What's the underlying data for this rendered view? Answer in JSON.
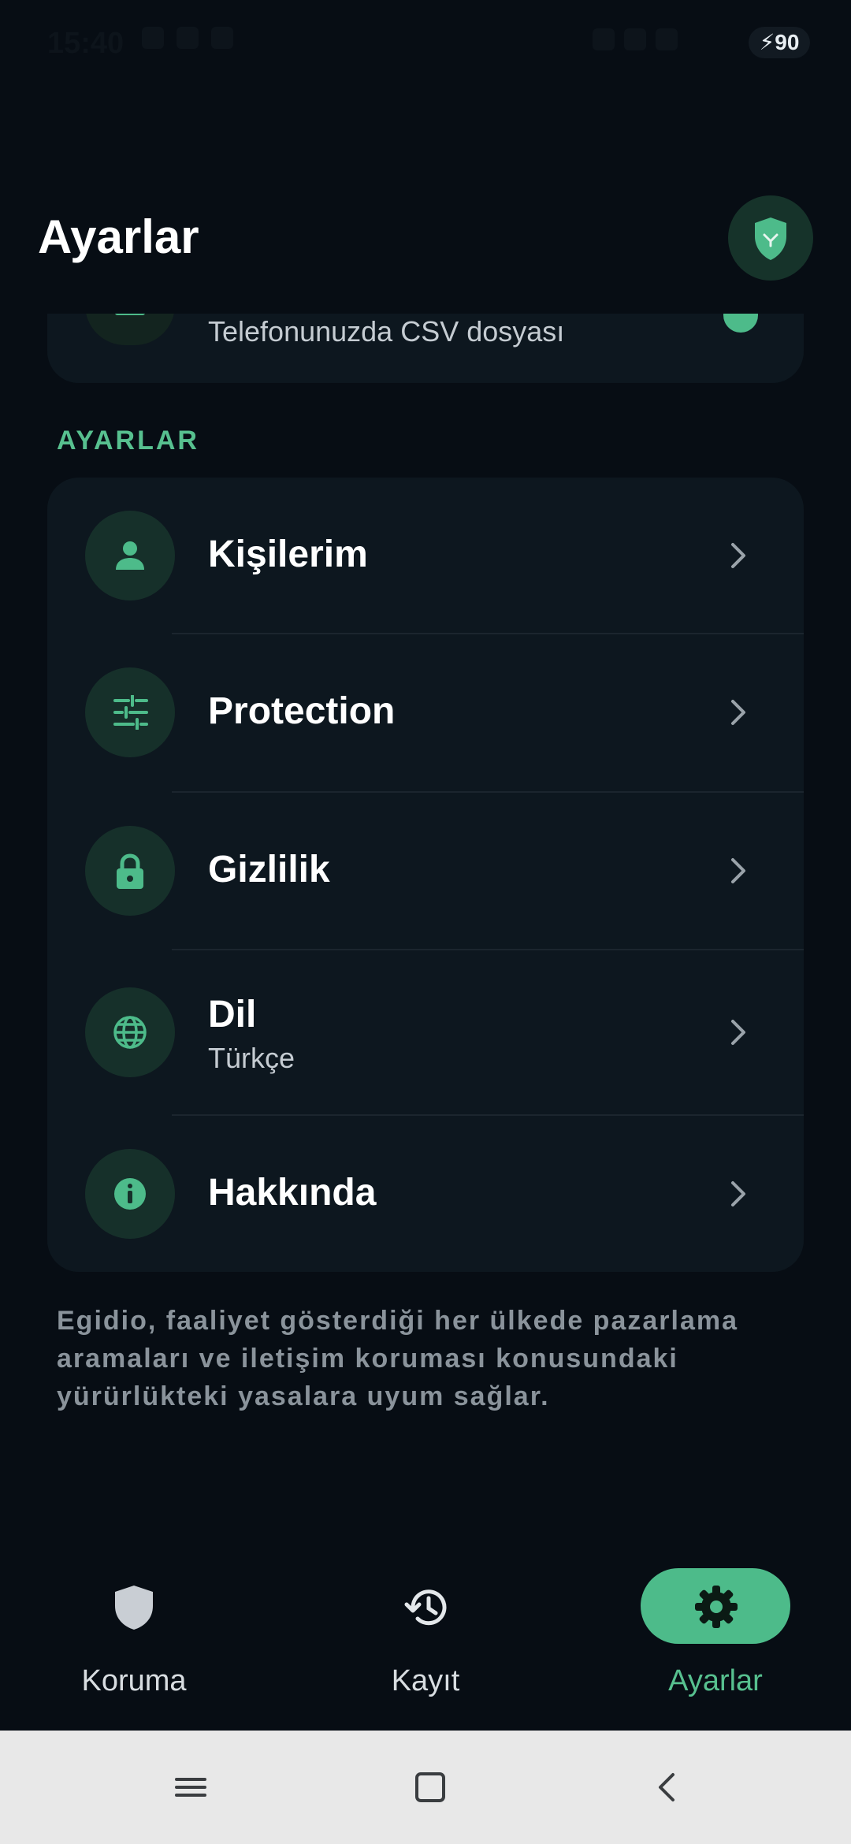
{
  "status_bar": {
    "time": "15:40",
    "battery": "90"
  },
  "header": {
    "title": "Ayarlar",
    "avatar_icon": "shield-icon"
  },
  "previous_card": {
    "subtitle": "Telefonunuzda CSV dosyası"
  },
  "settings": {
    "section_label": "AYARLAR",
    "items": [
      {
        "label": "Kişilerim",
        "sublabel": "",
        "icon": "person-icon"
      },
      {
        "label": "Protection",
        "sublabel": "",
        "icon": "sliders-icon"
      },
      {
        "label": "Gizlilik",
        "sublabel": "",
        "icon": "lock-icon"
      },
      {
        "label": "Dil",
        "sublabel": "Türkçe",
        "icon": "globe-icon"
      },
      {
        "label": "Hakkında",
        "sublabel": "",
        "icon": "info-icon"
      }
    ]
  },
  "footer_note": "Egidio, faaliyet gösterdiği her ülkede pazarlama aramaları ve iletişim koruması konusundaki yürürlükteki yasalara uyum sağlar.",
  "bottom_nav": {
    "items": [
      {
        "label": "Koruma",
        "icon": "shield-icon",
        "active": false
      },
      {
        "label": "Kayıt",
        "icon": "history-icon",
        "active": false
      },
      {
        "label": "Ayarlar",
        "icon": "gear-icon",
        "active": true
      }
    ]
  },
  "colors": {
    "background": "#070d14",
    "card": "#0d171f",
    "accent": "#4dbb8a",
    "accent_text": "#57c08f"
  }
}
